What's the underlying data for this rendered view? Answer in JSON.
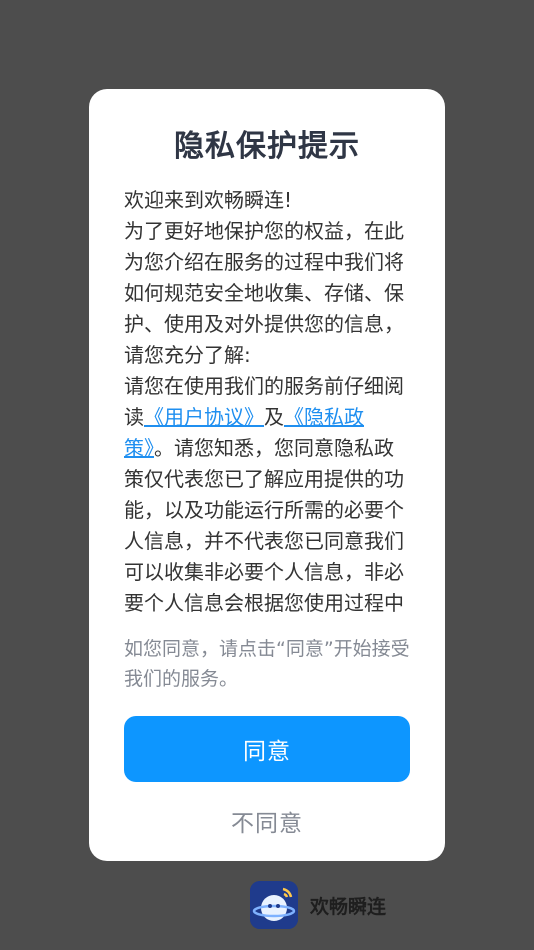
{
  "dialog": {
    "title": "隐私保护提示",
    "body": {
      "welcome": "欢迎来到欢畅瞬连!",
      "para1": "为了更好地保护您的权益，在此为您介绍在服务的过程中我们将如何规范安全地收集、存储、保护、使用及对外提供您的信息，请您充分了解:",
      "para2_prefix": "请您在使用我们的服务前仔细阅读",
      "user_agreement_link": "《用户协议》",
      "and_text": "及",
      "privacy_policy_link": "《隐私政策》",
      "para2_suffix": "。请您知悉，您同意隐私政策仅代表您已了解应用提供的功能，以及功能运行所需的必要个人信息，并不代表您已同意我们可以收集非必要个人信息，非必要个人信息会根据您使用过程中"
    },
    "notice": "如您同意，请点击“同意”开始接受我们的服务。",
    "agree_label": "同意",
    "disagree_label": "不同意"
  },
  "brand": {
    "app_name": "欢畅瞬连",
    "icon": "app-logo-icon"
  },
  "colors": {
    "overlay": "#4d4d4d",
    "primary": "#0d96ff",
    "link": "#1f8ff0",
    "title": "#2f3645",
    "muted": "#858a94"
  }
}
